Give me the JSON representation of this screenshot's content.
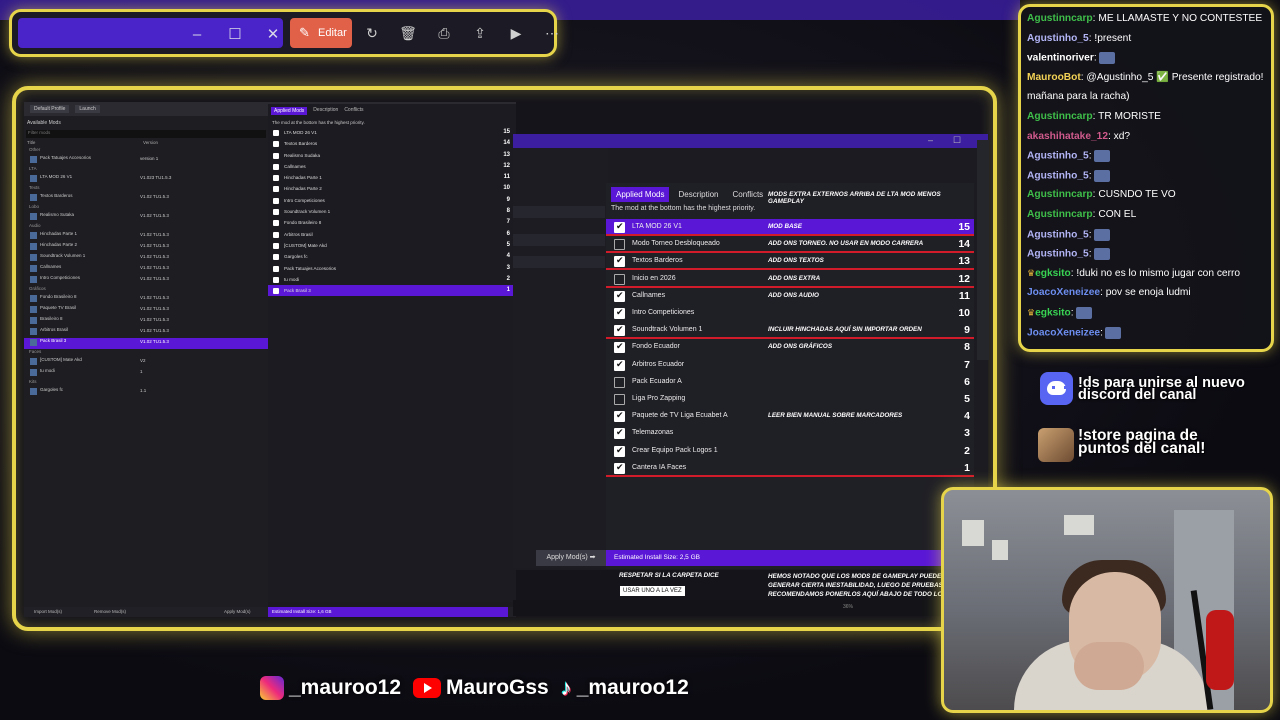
{
  "viewer": {
    "controls": {
      "minimize": "–",
      "maximize": "☐",
      "close": "✕"
    },
    "edit_label": "Editar",
    "icons": [
      "rotate-icon",
      "trash-icon",
      "print-icon",
      "share-icon",
      "slideshow-icon",
      "more-icon"
    ]
  },
  "small_manager": {
    "profile": "Default Profile",
    "launch": "Launch",
    "available_title": "Available Mods",
    "filter_placeholder": "Filter mods",
    "col_title": "Title",
    "col_version": "Version",
    "available_rows": [
      {
        "t": "Other",
        "g": true
      },
      {
        "t": "Pack Tatuajes Accesorios",
        "v": "version 1"
      },
      {
        "t": "LTA",
        "g": true
      },
      {
        "t": "LTA MOD 26 V1",
        "v": "V1.023 TU1.5.3"
      },
      {
        "t": "Texts",
        "g": true
      },
      {
        "t": "Textos Barderos",
        "v": "V1.02 TU1.5.3"
      },
      {
        "t": "Lobo",
        "g": true
      },
      {
        "t": "Realismo Sutaka",
        "v": "V1.02 TU1.5.3"
      },
      {
        "t": "Audio",
        "g": true
      },
      {
        "t": "Hinchadas Parte 1",
        "v": "V1.02 TU1.5.3"
      },
      {
        "t": "Hinchadas Parte 2",
        "v": "V1.02 TU1.5.3"
      },
      {
        "t": "Soundtrack Volumen 1",
        "v": "V1.02 TU1.5.3"
      },
      {
        "t": "Callnames",
        "v": "V1.02 TU1.5.3"
      },
      {
        "t": "Intro Competiciones",
        "v": "V1.02 TU1.5.3"
      },
      {
        "t": "Gráficos",
        "g": true
      },
      {
        "t": "Fondo Brasileiro 8",
        "v": "V1.02 TU1.5.3"
      },
      {
        "t": "Paquete TV Brasil",
        "v": "V1.02 TU1.5.3"
      },
      {
        "t": "Brasileiro 8",
        "v": "V1.02 TU1.5.3"
      },
      {
        "t": "Arbitros Brasil",
        "v": "V1.02 TU1.5.3"
      },
      {
        "t": "Pack Brasil 3",
        "v": "V1.02 TU1.5.3",
        "sel": true
      },
      {
        "t": "Faces",
        "g": true
      },
      {
        "t": "[CUSTOM] Mate Akd",
        "v": "V2"
      },
      {
        "t": "tu modi",
        "v": "1"
      },
      {
        "t": "Kits",
        "g": true
      },
      {
        "t": "Gargoles fc",
        "v": "1.1"
      }
    ],
    "tabs": [
      "Applied Mods",
      "Description",
      "Conflicts"
    ],
    "note": "The mod at the bottom has the highest priority.",
    "applied_rows": [
      {
        "t": "LTA MOD 26 V1",
        "n": "15"
      },
      {
        "t": "Textos Barderos",
        "n": "14"
      },
      {
        "t": "Realismo Sudaka",
        "n": "13"
      },
      {
        "t": "Callnames",
        "n": "12"
      },
      {
        "t": "Hinchadas Parte 1",
        "n": "11"
      },
      {
        "t": "Hinchadas Parte 2",
        "n": "10"
      },
      {
        "t": "Intro Competiciones",
        "n": "9"
      },
      {
        "t": "Soundtrack Volumen 1",
        "n": "8"
      },
      {
        "t": "Fondo Brasileiro 8",
        "n": "7"
      },
      {
        "t": "Arbitros Brasil",
        "n": "6"
      },
      {
        "t": "[CUSTOM] Mate Akd",
        "n": "5"
      },
      {
        "t": "Gargoles fc",
        "n": "4"
      },
      {
        "t": "Pack Tatuajes Accesorios",
        "n": "3"
      },
      {
        "t": "tu modi",
        "n": "2"
      },
      {
        "t": "Pack Brasil 3",
        "n": "1",
        "sel": true
      }
    ],
    "import": "Import Mod(s)",
    "remove": "Remove Mod(s)",
    "apply": "Apply Mod(s)",
    "est": "Estimated Install Size: 1,6 GB"
  },
  "large_manager": {
    "tabs": [
      "Applied Mods",
      "Description",
      "Conflicts"
    ],
    "note": "The mod at the bottom has the highest priority.",
    "header_tag": "MODS EXTRA EXTERNOS ARRIBA DE LTA MOD MENOS GAMEPLAY",
    "rows": [
      {
        "t": "LTA MOD 26 V1",
        "tag": "MOD BASE",
        "n": "15",
        "on": true,
        "sel": true,
        "red": true
      },
      {
        "t": "Modo Torneo Desbloqueado",
        "tag": "ADD ONS TORNEO. NO USAR EN MODO CARRERA",
        "n": "14",
        "on": false,
        "red": true
      },
      {
        "t": "Textos Barderos",
        "tag": "ADD ONS TEXTOS",
        "n": "13",
        "on": true,
        "red": true
      },
      {
        "t": "Inicio en 2026",
        "tag": "ADD ONS EXTRA",
        "n": "12",
        "on": false,
        "red": true
      },
      {
        "t": "Callnames",
        "tag": "ADD ONS AUDIO",
        "n": "11",
        "on": true
      },
      {
        "t": "Intro Competiciones",
        "tag": "",
        "n": "10",
        "on": true
      },
      {
        "t": "Soundtrack Volumen 1",
        "tag": "INCLUIR HINCHADAS AQUÍ SIN IMPORTAR ORDEN",
        "n": "9",
        "on": true,
        "red": true
      },
      {
        "t": "Fondo Ecuador",
        "tag": "ADD ONS GRÁFICOS",
        "n": "8",
        "on": true
      },
      {
        "t": "Arbitros Ecuador",
        "tag": "",
        "n": "7",
        "on": true
      },
      {
        "t": "Pack Ecuador A",
        "tag": "",
        "n": "6",
        "on": false
      },
      {
        "t": "Liga Pro Zapping",
        "tag": "",
        "n": "5",
        "on": false
      },
      {
        "t": "Paquete de TV Liga Ecuabet A",
        "tag": "LEER BIEN MANUAL SOBRE MARCADORES",
        "n": "4",
        "on": true
      },
      {
        "t": "Telemazonas",
        "tag": "",
        "n": "3",
        "on": true
      },
      {
        "t": "Crear Equipo Pack Logos 1",
        "tag": "",
        "n": "2",
        "on": true
      },
      {
        "t": "Cantera IA Faces",
        "tag": "",
        "n": "1",
        "on": true,
        "red": true
      }
    ],
    "warn1": "RESPETAR SI LA CARPETA DICE",
    "warn_btn": "USAR UNO A LA VEZ",
    "warn2": "HEMOS NOTADO QUE LOS MODS DE GAMEPLAY PUEDEN GENERAR CIERTA INESTABILIDAD, LUEGO DE PRUEBAS RECOMENDAMOS PONERLOS AQUÍ ABAJO DE TODO LOS MODS DE LTA.",
    "apply": "Apply Mod(s) ➡",
    "est": "Estimated Install Size: 2,5 GB",
    "zoom": "36%"
  },
  "chat": [
    {
      "u": "Agustinncarp",
      "c": "#3fbf4a",
      "m": ": ME LLAMASTE Y NO CONTESTEE"
    },
    {
      "u": "Agustinho_5",
      "c": "#b2b4f5",
      "m": ": !present"
    },
    {
      "u": "valentinoriver",
      "c": "#ffffff",
      "m": ":",
      "emote": true
    },
    {
      "u": "MaurooBot",
      "c": "#f3d255",
      "m": ": @Agustinho_5 ✅ Presente registrado!"
    },
    {
      "u": "",
      "c": "#ffffff",
      "m": "mañana para la racha)"
    },
    {
      "u": "Agustinncarp",
      "c": "#3fbf4a",
      "m": ": TR MORISTE"
    },
    {
      "u": "akashihatake_12",
      "c": "#d05a8c",
      "m": ": xd?"
    },
    {
      "u": "Agustinho_5",
      "c": "#b2b4f5",
      "m": ":",
      "emote": true
    },
    {
      "u": "Agustinho_5",
      "c": "#b2b4f5",
      "m": ":",
      "emote": true
    },
    {
      "u": "Agustinncarp",
      "c": "#3fbf4a",
      "m": ": CUSNDO TE VO"
    },
    {
      "u": "Agustinncarp",
      "c": "#3fbf4a",
      "m": ": CON EL"
    },
    {
      "u": "Agustinho_5",
      "c": "#b2b4f5",
      "m": ":",
      "emote": true
    },
    {
      "u": "Agustinho_5",
      "c": "#b2b4f5",
      "m": ":",
      "emote": true
    },
    {
      "u": "egksito",
      "c": "#39d353",
      "m": ": !duki no es lo mismo jugar con cerro",
      "crown": true
    },
    {
      "u": "JoacoXeneizee",
      "c": "#6d8ef0",
      "m": ": pov se enoja ludmi"
    },
    {
      "u": "egksito",
      "c": "#39d353",
      "m": ":",
      "crown": true,
      "emote": true
    },
    {
      "u": "JoacoXeneizee",
      "c": "#6d8ef0",
      "m": ":",
      "emote": true
    }
  ],
  "promo": {
    "discord": [
      "!ds para unirse al nuevo",
      "discord del canal"
    ],
    "store": [
      "!store pagina de",
      "puntos del canal!"
    ]
  },
  "socials": {
    "instagram": "_mauroo12",
    "youtube": "MauroGss",
    "tiktok": "_mauroo12"
  }
}
